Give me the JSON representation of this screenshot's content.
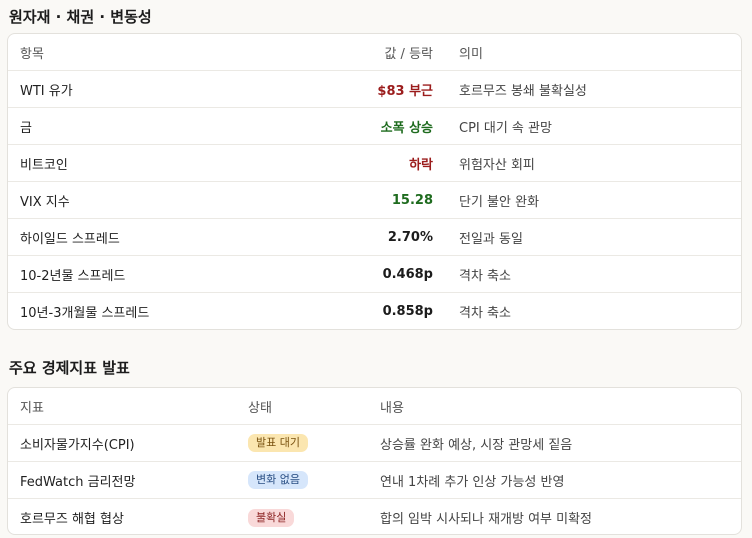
{
  "section1": {
    "title": "원자재 · 채권 · 변동성",
    "headers": {
      "item": "항목",
      "value": "값 / 등락",
      "meaning": "의미"
    },
    "rows": [
      {
        "item": "WTI 유가",
        "value": "$83 부근",
        "meaning": "호르무즈 봉쇄 불확실성",
        "value_color": "#9b1c1c"
      },
      {
        "item": "금",
        "value": "소폭 상승",
        "meaning": "CPI 대기 속 관망",
        "value_color": "#1e6b1e"
      },
      {
        "item": "비트코인",
        "value": "하락",
        "meaning": "위험자산 회피",
        "value_color": "#9b1c1c"
      },
      {
        "item": "VIX 지수",
        "value": "15.28",
        "meaning": "단기 불안 완화",
        "value_color": "#1e6b1e"
      },
      {
        "item": "하이일드 스프레드",
        "value": "2.70%",
        "meaning": "전일과 동일",
        "value_color": "#1c1c1c"
      },
      {
        "item": "10-2년물 스프레드",
        "value": "0.468p",
        "meaning": "격차 축소",
        "value_color": "#1c1c1c"
      },
      {
        "item": "10년-3개월물 스프레드",
        "value": "0.858p",
        "meaning": "격차 축소",
        "value_color": "#1c1c1c"
      }
    ]
  },
  "section2": {
    "title": "주요 경제지표 발표",
    "headers": {
      "indicator": "지표",
      "status": "상태",
      "content": "내용"
    },
    "rows": [
      {
        "indicator": "소비자물가지수(CPI)",
        "status": "발표 대기",
        "content": "상승률 완화 예상, 시장 관망세 짙음",
        "badge_color": "yellow"
      },
      {
        "indicator": "FedWatch 금리전망",
        "status": "변화 없음",
        "content": "연내 1차례 추가 인상 가능성 반영",
        "badge_color": "blue"
      },
      {
        "indicator": "호르무즈 해협 협상",
        "status": "불확실",
        "content": "합의 임박 시사되나 재개방 여부 미확정",
        "badge_color": "red"
      }
    ]
  }
}
